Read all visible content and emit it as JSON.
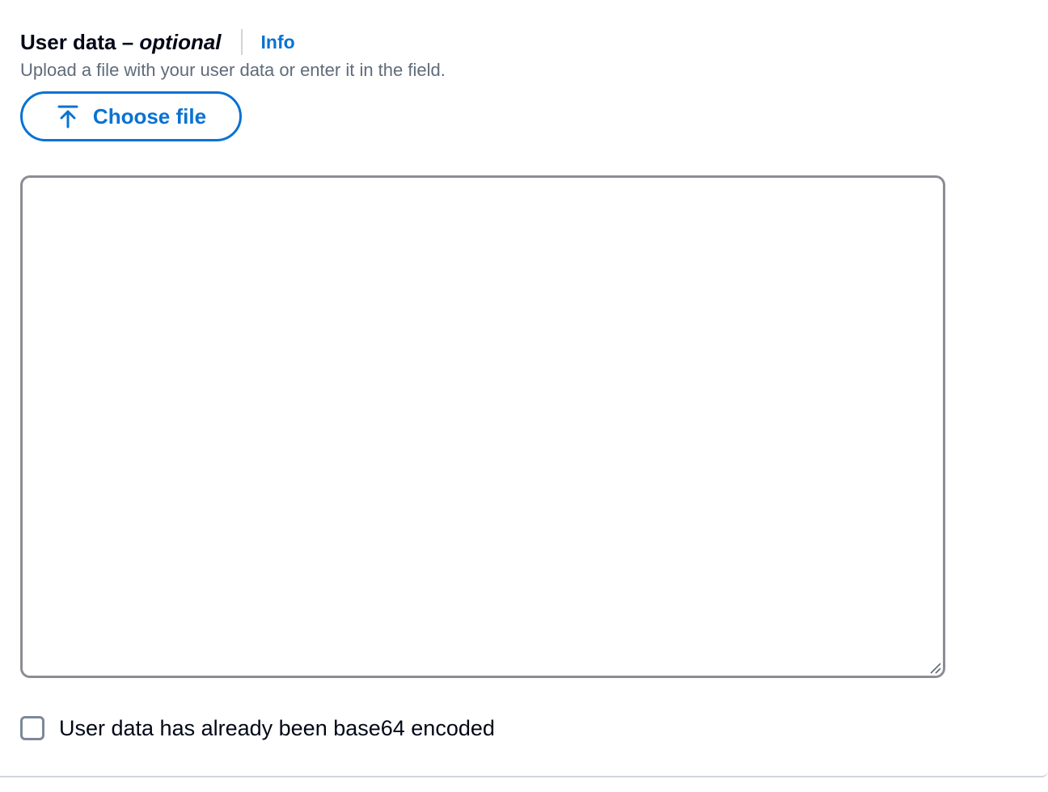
{
  "field": {
    "label": "User data",
    "separator": " – ",
    "optional": "optional",
    "info_link": "Info",
    "description": "Upload a file with your user data or enter it in the field."
  },
  "upload": {
    "button_label": "Choose file",
    "icon": "upload-arrow-icon"
  },
  "user_data_input": {
    "value": "",
    "placeholder": ""
  },
  "base64_checkbox": {
    "label": "User data has already been base64 encoded",
    "checked": false
  },
  "colors": {
    "link": "#0972d3",
    "text": "#000716",
    "secondary_text": "#5f6b7a",
    "input_border": "#8c8c94"
  }
}
